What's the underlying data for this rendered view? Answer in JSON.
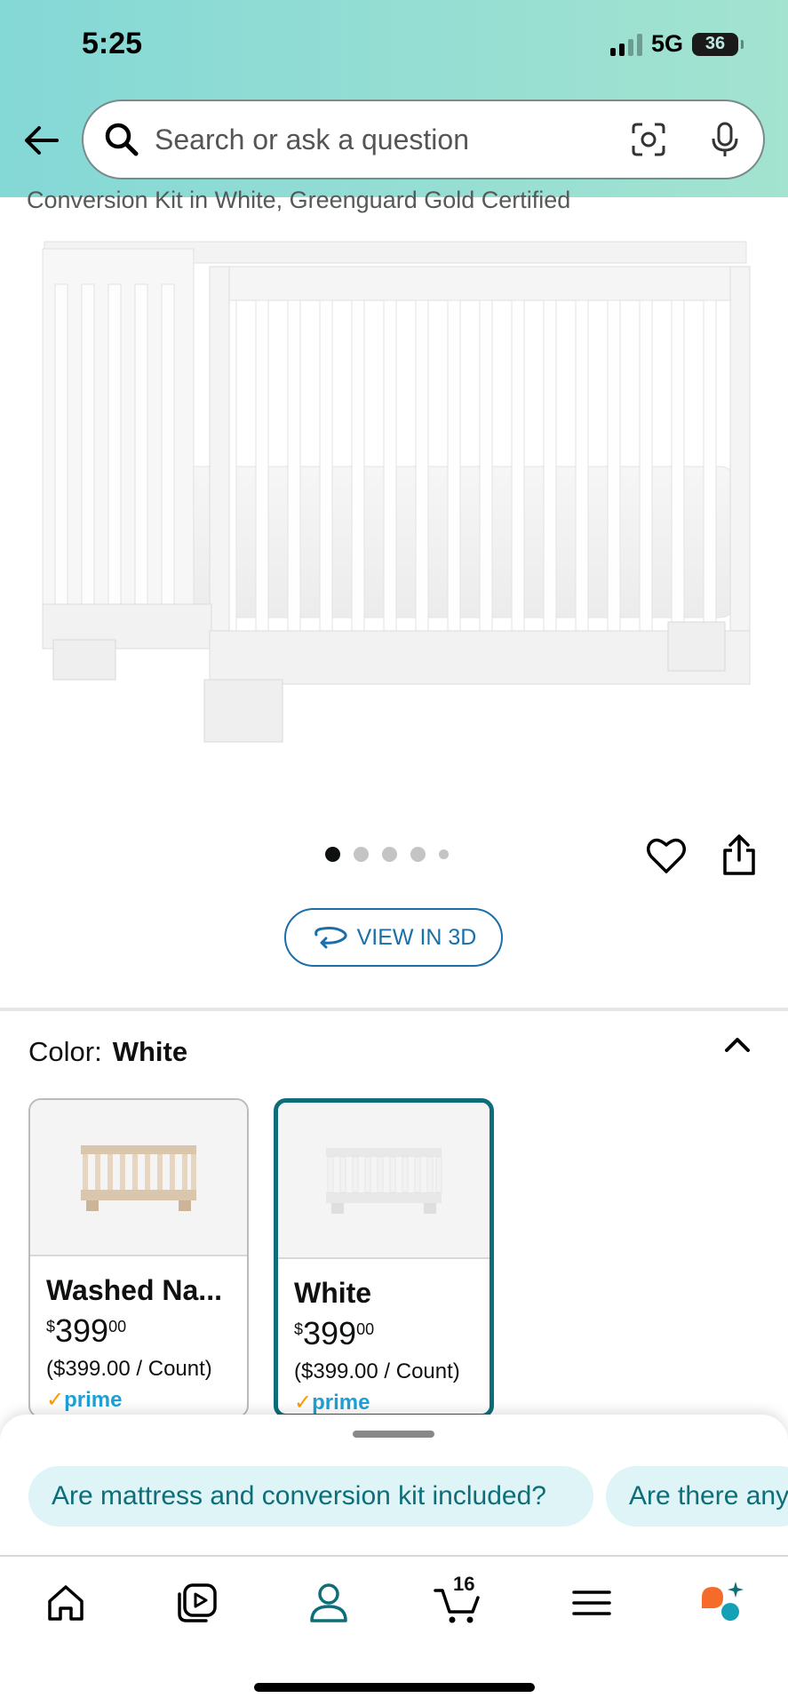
{
  "status_bar": {
    "time": "5:25",
    "network": "5G",
    "battery": "36"
  },
  "search": {
    "placeholder": "Search or ask a question"
  },
  "product": {
    "title_fragment": "Conversion Kit in White, Greenguard Gold Certified",
    "image_count": 5,
    "active_image_index": 0
  },
  "view_3d": {
    "label": "VIEW IN 3D"
  },
  "color": {
    "label": "Color:",
    "selected": "White"
  },
  "swatches": [
    {
      "name": "Washed Na...",
      "currency": "$",
      "dollars": "399",
      "cents": "00",
      "unit_price": "($399.00 / Count)",
      "prime_check": "✓",
      "prime": "prime",
      "selected": false
    },
    {
      "name": "White",
      "currency": "$",
      "dollars": "399",
      "cents": "00",
      "unit_price": "($399.00 / Count)",
      "prime_check": "✓",
      "prime": "prime",
      "selected": true
    }
  ],
  "suggestions": [
    "Are mattress and conversion kit included?",
    "Are there any"
  ],
  "tabbar": {
    "cart_count": "16"
  },
  "icons": {
    "back": "arrow-left-icon",
    "search": "search-icon",
    "camera": "camera-scan-icon",
    "mic": "microphone-icon",
    "heart": "heart-icon",
    "share": "share-icon",
    "collapse": "chevron-up-icon",
    "home": "home-icon",
    "video": "video-icon",
    "account": "person-icon",
    "cart": "cart-icon",
    "menu": "menu-icon",
    "rufus": "rufus-icon"
  },
  "colors": {
    "header_start": "#84d8d6",
    "header_end": "#a3e3d0",
    "link_blue": "#1a6fa8",
    "teal": "#0d6e79",
    "chip_bg": "#dff4f6",
    "prime_blue": "#1ea0d6",
    "orange": "#ff9900"
  }
}
